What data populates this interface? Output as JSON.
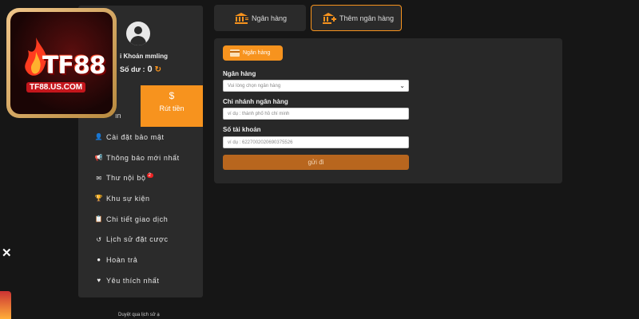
{
  "logo": {
    "brand": "TF88",
    "url": "TF88.US.COM"
  },
  "profile": {
    "account_label": "i Khoản mmling",
    "balance_label": "Số dư :",
    "balance_value": "0"
  },
  "sidebar": {
    "tab_left_label": "ın",
    "withdraw_label": "Rút tiền",
    "menu": [
      {
        "icon": "user-gear-icon",
        "label": "Cài đặt bảo mật"
      },
      {
        "icon": "megaphone-icon",
        "label": "Thông báo mới nhất"
      },
      {
        "icon": "envelope-icon",
        "label": "Thư nội bộ",
        "badge": "2"
      },
      {
        "icon": "trophy-icon",
        "label": "Khu sự kiện"
      },
      {
        "icon": "clipboard-icon",
        "label": "Chi tiết giao dịch"
      },
      {
        "icon": "history-icon",
        "label": "Lịch sử đặt cược"
      },
      {
        "icon": "dollar-circle-icon",
        "label": "Hoàn trả"
      },
      {
        "icon": "heart-icon",
        "label": "Yêu thích nhất"
      }
    ]
  },
  "top_tabs": {
    "bank": "Ngân hàng",
    "add_bank": "Thêm ngân hàng"
  },
  "form": {
    "chip_label": "Ngân hàng",
    "bank_label": "Ngân hàng",
    "bank_select_value": "Vui lòng chọn ngân hàng",
    "branch_label": "Chi nhánh ngân hàng",
    "branch_placeholder": "ví dụ : thành phố hồ chí minh",
    "account_label": "Số tài khoản",
    "account_placeholder": "ví dụ : 6227002020690375526",
    "submit_label": "gửi đi"
  },
  "footer": {
    "text": "Duyệt qua lịch sử ạ"
  },
  "colors": {
    "accent": "#f7931e",
    "panel": "#282828",
    "background": "#161616"
  }
}
